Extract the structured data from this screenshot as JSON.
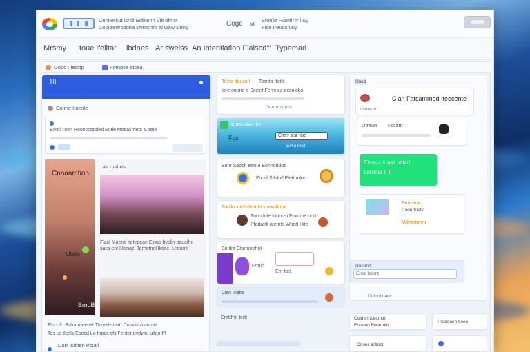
{
  "topbar": {
    "line1": "Connersut isnitl Edbtenh Vilt ofinct",
    "line2": "Copurertrotiona stvntsrtrd ai waw sieng",
    "center": "Coge",
    "right_a": "Mi",
    "right_b_line1": "Stonliz Fvatitir ir l &y",
    "right_b_line2": "Fioe Ireiarsfuny"
  },
  "menu": [
    "Mrsmy",
    "toue lfeiltar",
    "lbdnes",
    "Ar swelss",
    "An Intentlatlon Flaiscd'''",
    "Typemad"
  ],
  "board": {
    "tab_title": "Good : lecltip",
    "tab_status": "Fotnoce atceu"
  },
  "col1": {
    "header_text": "1lI",
    "post_author": "Cotme Inienle",
    "post_body": "Exrdl Toon Hoonsotebled Eutle Mosasrrlep: Coeto",
    "image1_caption": "Cnnaamtion",
    "image2_tag": "#s ruvbrts",
    "side_label1": "Utelo",
    "side_label2": "BmoB",
    "image_body": "Fiacl Muenc lretepeae Elnuo bvclin bauelhe sacs ent Hisnaz: Tarnofnol lkdce. Lncuml sonlmfe Erelio",
    "footer1": "Flncdfrt Prtiounatenat Tfrnertlsttiatt Colnrtisvtlcnpttz",
    "footer2": "Tes us tllefls Eoecd Lo tnpdit cfs Fenter uvdyou utlen Pl",
    "bottom": "Corr tslthen Pcutil"
  },
  "col2": {
    "card1_line1": "Tolne tfaucn l",
    "card1_line2": "Tosnta rlattlt",
    "card1_line3": "Iore oulrnd e Scelnt Ferresut ocsolobs",
    "card1_foot": "Oturrnn nrttts",
    "card2_tag": "Cmrt ouleu rhs",
    "card2_btn": "Cmrr slsr tcct",
    "card2_btn2": "Eilflo tvcit",
    "card2_label": "Fcs",
    "card3_title": "Eenr Saoch eirruu Eonnoddob",
    "card3_body": "Fhcsf Stlslotl Elettnnlre",
    "card4_title": "Fouilooctel sleottet soewdnrur",
    "card4_line1": "Foon fuie Irtoonsi Pintoine unrt",
    "card4_line2": "Pfadatrlt atcrnts Wood Hite",
    "card5_title": "Enrilnt Ctsrmotrhnt",
    "card5_line1": "Frtnln",
    "card5_line2": "Ent ttet",
    "row_label": "Clsn Tlelnr",
    "bottom_label": "Erattfhn lertt"
  },
  "col3": {
    "tag": "Snod",
    "title": "Cian Fatcammed Iteocente",
    "sub": "Lcnemtt",
    "row1": "Lnraurt",
    "row2": "Focatrt",
    "green_title": "Elsstcc tiruaI obtcd",
    "green_sub": "Loroow T T",
    "card_title": "Eotoctuo",
    "card_sub": "Mdnsrtonru",
    "card_small": "Coourtoeflc",
    "input_label": "Trocnnrt",
    "input_value": "Enoc loornt",
    "foot_link": "Cotrtoi uarz",
    "status_a": "Colmtn toelpntn",
    "status_b": "Enreeto Feoruntlr",
    "status_c": "Tnadouen tioee",
    "status_d": "Cnonr at lloct"
  },
  "colors": {
    "accent": "#2f5de0",
    "green": "#1fe27a",
    "purple": "#7a3cd0"
  }
}
